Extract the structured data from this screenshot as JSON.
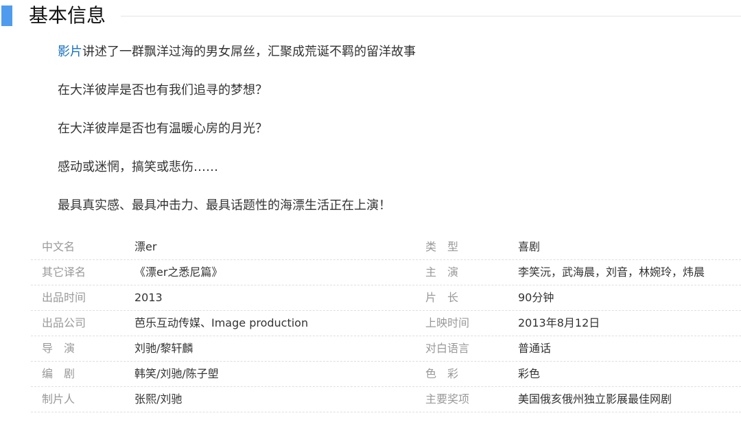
{
  "section": {
    "title": "基本信息"
  },
  "intro": {
    "link_text": "影片",
    "line1_rest": "讲述了一群飘洋过海的男女屌丝，汇聚成荒诞不羁的留洋故事",
    "lines": [
      "在大洋彼岸是否也有我们追寻的梦想？",
      "在大洋彼岸是否也有温暖心房的月光？",
      "感动或迷惘，搞笑或悲伤……",
      "最具真实感、最具冲击力、最具话题性的海漂生活正在上演！"
    ]
  },
  "info_rows": [
    {
      "k1": "中文名",
      "v1": "漂er",
      "k2": "类　型",
      "v2": "喜剧"
    },
    {
      "k1": "其它译名",
      "v1": "《漂er之悉尼篇》",
      "k2": "主　演",
      "v2": "李笑沅，武海晨，刘音，林婉玲，炜晨"
    },
    {
      "k1": "出品时间",
      "v1": "2013",
      "k2": "片　长",
      "v2": "90分钟"
    },
    {
      "k1": "出品公司",
      "v1": "芭乐互动传媒、Image production",
      "k2": "上映时间",
      "v2": "2013年8月12日"
    },
    {
      "k1": "导　演",
      "v1": "刘驰/黎轩麟",
      "k2": "对白语言",
      "v2": "普通话"
    },
    {
      "k1": "编　剧",
      "v1": "韩笑/刘驰/陈子塱",
      "k2": "色　彩",
      "v2": "彩色"
    },
    {
      "k1": "制片人",
      "v1": "张熙/刘驰",
      "k2": "主要奖项",
      "v2": "美国俄亥俄州独立影展最佳网剧"
    }
  ],
  "colors": {
    "accent_bar": "#4f9cee",
    "link": "#136ec2",
    "label": "#999999",
    "value": "#333333"
  }
}
